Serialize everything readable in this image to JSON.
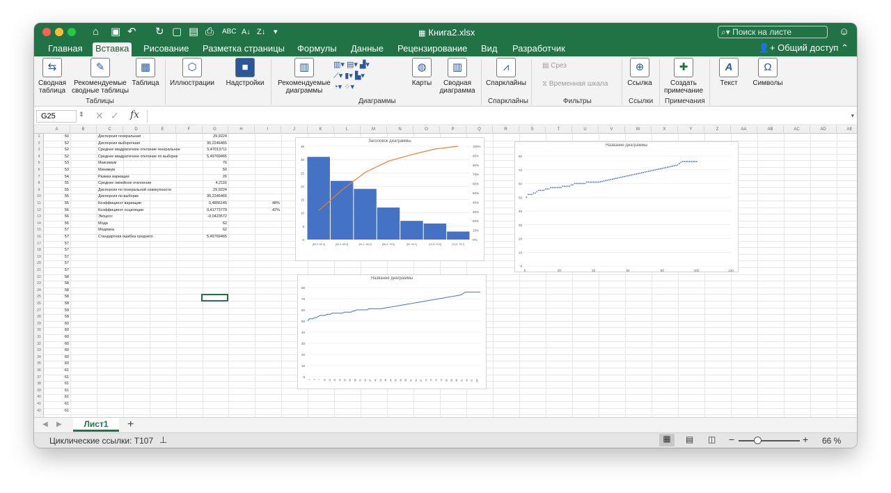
{
  "window": {
    "title": "Книга2.xlsx",
    "search_placeholder": "Поиск на листе",
    "share": "Общий доступ"
  },
  "ribbon_tabs": [
    "Главная",
    "Вставка",
    "Рисование",
    "Разметка страницы",
    "Формулы",
    "Данные",
    "Рецензирование",
    "Вид",
    "Разработчик"
  ],
  "active_tab": "Вставка",
  "ribbon": {
    "pivot": [
      "Сводная",
      "таблица"
    ],
    "rec_pivot": [
      "Рекомендуемые",
      "сводные таблицы"
    ],
    "table": "Таблица",
    "group_tables": "Таблицы",
    "illustrations": "Иллюстрации",
    "addins": "Надстройки",
    "rec_charts": [
      "Рекомендуемые",
      "диаграммы"
    ],
    "maps": "Карты",
    "pivot_chart": [
      "Сводная",
      "диаграмма"
    ],
    "group_charts": "Диаграммы",
    "sparklines": "Спарклайны",
    "group_sparklines": "Спарклайны",
    "slicer": "Срез",
    "timeline": "Временная шкала",
    "group_filters": "Фильтры",
    "link": "Ссылка",
    "group_links": "Ссылки",
    "new_comment": [
      "Создать",
      "примечание"
    ],
    "group_comments": "Примечания",
    "text": "Текст",
    "symbols": "Символы"
  },
  "formula_bar": {
    "name_box": "G25",
    "fx": "fx",
    "formula": ""
  },
  "columns": [
    "A",
    "B",
    "C",
    "D",
    "E",
    "F",
    "G",
    "H",
    "I",
    "J",
    "K",
    "L",
    "M",
    "N",
    "O",
    "P",
    "Q",
    "R",
    "S",
    "T",
    "U",
    "V",
    "W",
    "X",
    "Y",
    "Z",
    "AA",
    "AB",
    "AC",
    "AD",
    "AE"
  ],
  "rows": [
    "1",
    "2",
    "3",
    "4",
    "5",
    "6",
    "7",
    "8",
    "9",
    "10",
    "11",
    "12",
    "13",
    "14",
    "15",
    "16",
    "17",
    "18",
    "19",
    "20",
    "21",
    "22",
    "23",
    "24",
    "25",
    "26",
    "27",
    "28",
    "29",
    "30",
    "31",
    "32",
    "33",
    "34",
    "35",
    "36",
    "37",
    "38",
    "39",
    "40",
    "41",
    "42"
  ],
  "col_a": [
    "50",
    "52",
    "52",
    "52",
    "53",
    "53",
    "54",
    "55",
    "55",
    "55",
    "55",
    "56",
    "56",
    "56",
    "57",
    "57",
    "57",
    "57",
    "57",
    "57",
    "57",
    "58",
    "58",
    "58",
    "58",
    "58",
    "59",
    "59",
    "60",
    "60",
    "60",
    "60",
    "60",
    "60",
    "60",
    "61",
    "61",
    "61",
    "61",
    "61",
    "61",
    "61"
  ],
  "stats": [
    {
      "label": "Дисперсия генеральная",
      "value": "29,9224",
      "pct": ""
    },
    {
      "label": "Дисперсия выборочная",
      "value": "30,2246465",
      "pct": ""
    },
    {
      "label": "Среднее квадратичное отклоние генеральное",
      "value": "5,47013711",
      "pct": ""
    },
    {
      "label": "Среднее квадратичное отклоние по выборке",
      "value": "5,49769465",
      "pct": ""
    },
    {
      "label": "Максимум",
      "value": "76",
      "pct": ""
    },
    {
      "label": "Минимум",
      "value": "50",
      "pct": ""
    },
    {
      "label": "Размах вариации",
      "value": "26",
      "pct": ""
    },
    {
      "label": "Среднее линейное отклоение",
      "value": "4,2116",
      "pct": ""
    },
    {
      "label": "Дисперсия по генеральной совокупности",
      "value": "29,9224",
      "pct": ""
    },
    {
      "label": "Дисперсия по выборке",
      "value": "30,2246465",
      "pct": ""
    },
    {
      "label": "Коэффициент вариации",
      "value": "0,4856145",
      "pct": "48%"
    },
    {
      "label": "Коэффициент осциляции",
      "value": "0,41773779",
      "pct": "42%"
    },
    {
      "label": "Эксцесс",
      "value": "-0,0423572",
      "pct": ""
    },
    {
      "label": "Мода",
      "value": "62",
      "pct": ""
    },
    {
      "label": "Медиана",
      "value": "62",
      "pct": ""
    },
    {
      "label": "Стандартная ошибка среднего",
      "value": "5,49769465",
      "pct": ""
    }
  ],
  "chart_data": [
    {
      "type": "bar",
      "title": "Заголовок диаграммы",
      "categories": [
        "[50,2; 62,3]",
        "[62,3; 66,4]",
        "[54,1; 58,2]",
        "[66,4; 70,5]",
        "[50; 54,1]",
        "[70,5; 74,6]",
        "[74,6; 78,7]"
      ],
      "values": [
        31,
        22,
        19,
        12,
        7,
        6,
        3
      ],
      "ylim": [
        0,
        35
      ],
      "yticks": [
        "0",
        "5",
        "10",
        "15",
        "20",
        "25",
        "30",
        "35"
      ],
      "y2ticks": [
        "0%",
        "10%",
        "20%",
        "30%",
        "40%",
        "50%",
        "60%",
        "70%",
        "80%",
        "90%",
        "100%"
      ],
      "cumulative_pct": [
        31,
        53,
        72,
        84,
        91,
        97,
        100
      ],
      "bar_color": "#4472c4",
      "line_color": "#ed7d31"
    },
    {
      "type": "scatter",
      "title": "Название диаграммы",
      "xlim": [
        0,
        120
      ],
      "ylim": [
        0,
        80
      ],
      "xticks": [
        "0",
        "20",
        "40",
        "60",
        "80",
        "100",
        "120"
      ],
      "yticks": [
        "0",
        "10",
        "20",
        "30",
        "40",
        "50",
        "60",
        "70",
        "80"
      ],
      "color": "#4472c4"
    },
    {
      "type": "line",
      "title": "Название диаграммы",
      "ylim": [
        0,
        80
      ],
      "yticks": [
        "0",
        "10",
        "20",
        "30",
        "40",
        "50",
        "60",
        "70",
        "80"
      ],
      "xticks": [
        "1",
        "4",
        "7",
        "10",
        "13",
        "16",
        "19",
        "22",
        "25",
        "28",
        "31",
        "34",
        "37",
        "40",
        "43",
        "46",
        "49",
        "52",
        "55",
        "58",
        "61",
        "64",
        "67",
        "70",
        "73",
        "76",
        "79",
        "82",
        "85",
        "88",
        "91",
        "94",
        "97",
        "100"
      ],
      "color": "#4472c4"
    }
  ],
  "sheet_tab": "Лист1",
  "status": {
    "circular": "Циклические ссылки: T107",
    "zoom": "66 %"
  }
}
